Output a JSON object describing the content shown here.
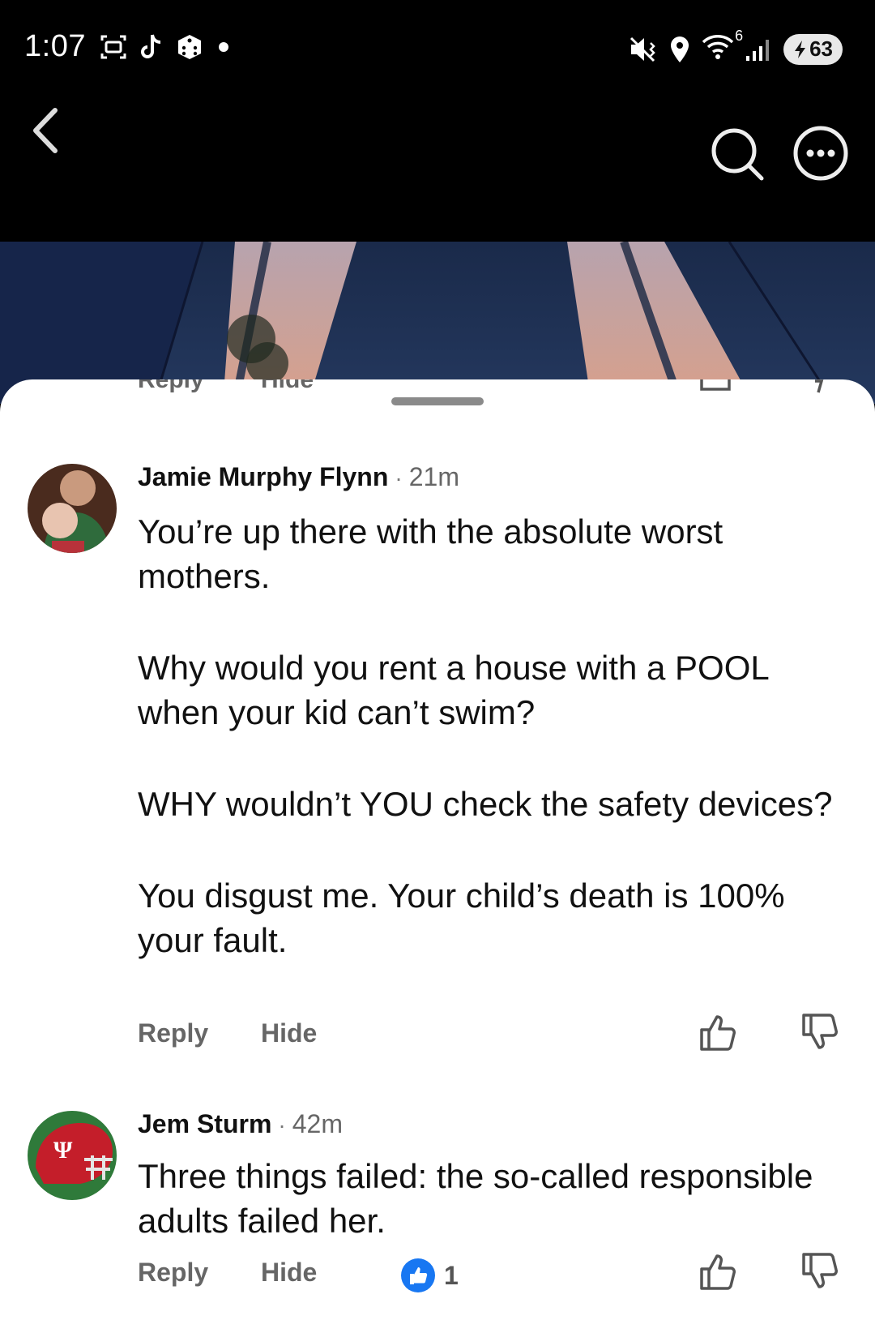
{
  "status_bar": {
    "time": "1:07",
    "wifi_badge": "6",
    "battery": "63",
    "icons_left": [
      "screenshot-icon",
      "tiktok-icon",
      "dice-icon",
      "dot-icon"
    ],
    "icons_right": [
      "mute-vibrate-icon",
      "location-icon",
      "wifi-icon",
      "signal-icon",
      "battery-icon"
    ]
  },
  "nav": {
    "icons": [
      "back-chevron-icon",
      "search-icon",
      "more-icon"
    ]
  },
  "previous_comment": {
    "reply_label": "Reply",
    "hide_label": "Hide"
  },
  "comments": [
    {
      "author": "Jamie Murphy Flynn",
      "separator": "·",
      "time_ago": "21m",
      "paragraphs": [
        "You’re up there with the absolute worst mothers.",
        "Why would you rent a house with a POOL when your kid can’t swim?",
        "WHY wouldn’t YOU check the safety devices?",
        "You disgust me. Your child’s death is 100% your fault."
      ],
      "reply_label": "Reply",
      "hide_label": "Hide"
    },
    {
      "author": "Jem Sturm",
      "separator": "·",
      "time_ago": "42m",
      "paragraphs": [
        "Three things failed: the so-called responsible adults failed her."
      ],
      "reply_label": "Reply",
      "hide_label": "Hide",
      "like_count": "1"
    }
  ],
  "colors": {
    "like_blue": "#1877F2",
    "muted_text": "#666666",
    "sheet_bg": "#FFFFFF"
  }
}
